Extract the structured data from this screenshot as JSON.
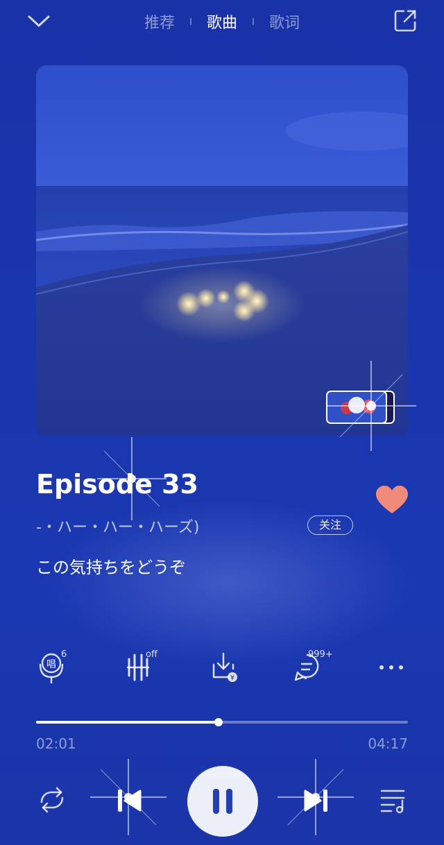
{
  "header": {
    "tabs": [
      {
        "label": "推荐",
        "active": false
      },
      {
        "label": "歌曲",
        "active": true
      },
      {
        "label": "歌词",
        "active": false
      }
    ],
    "back_icon": "chevron-down-icon",
    "share_icon": "external-share-icon"
  },
  "song": {
    "title": "Episode 33",
    "artist": "-・ハー・ハー・ハーズ)",
    "follow_label": "关注",
    "lyric": "この気持ちをどうぞ",
    "liked": true
  },
  "actions": {
    "sing_badge": "6",
    "effect_badge": "off",
    "comment_badge": "999+"
  },
  "player": {
    "current_time": "02:01",
    "total_time": "04:17",
    "progress": 0.49
  },
  "colors": {
    "background": "#1a36ae",
    "like": "#f08a7a",
    "accent": "#ffffff"
  }
}
